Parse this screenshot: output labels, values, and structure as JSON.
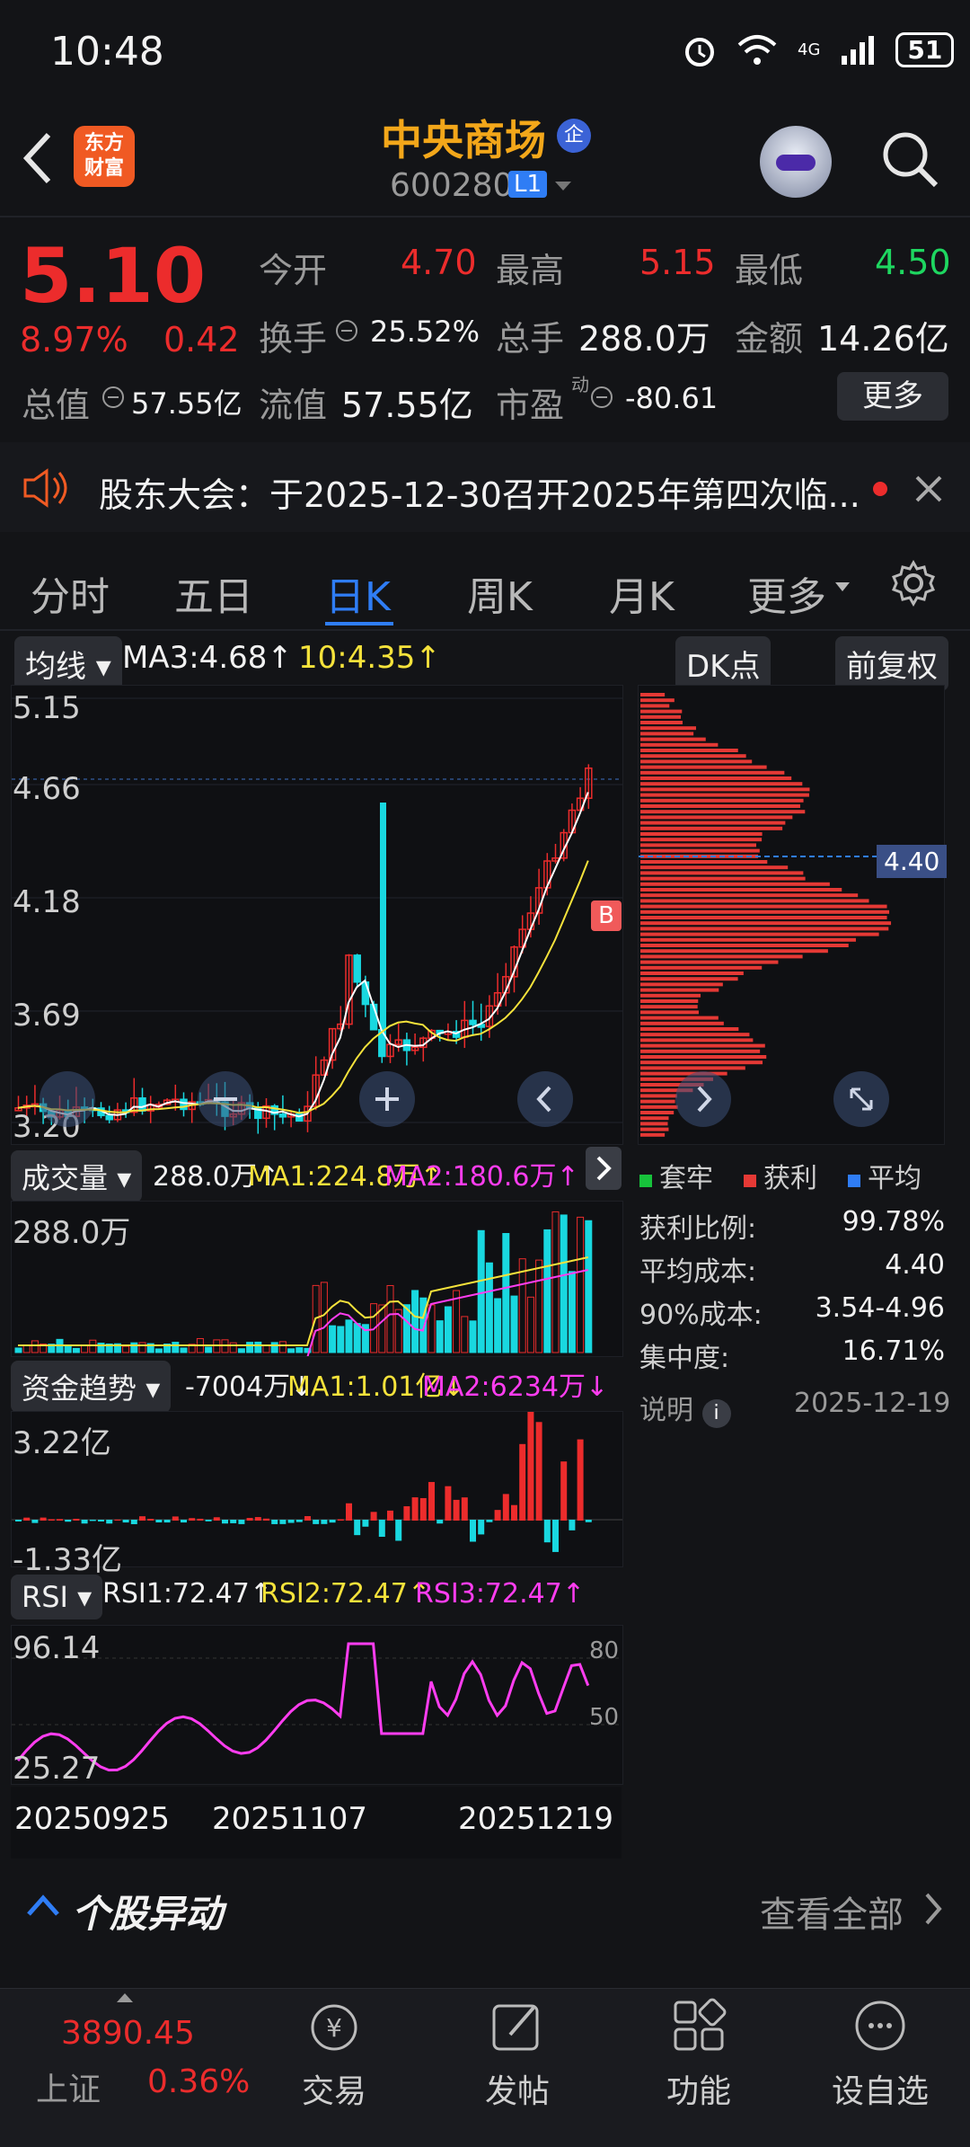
{
  "status_bar": {
    "time": "10:48",
    "battery": "51",
    "signal": "4G"
  },
  "header": {
    "logo_line1": "东方",
    "logo_line2": "财富",
    "stock_name": "中央商场",
    "badge": "企",
    "code": "600280",
    "level": "L1"
  },
  "quote": {
    "price": "5.10",
    "change_pct": "8.97%",
    "change": "0.42",
    "open_label": "今开",
    "open": "4.70",
    "high_label": "最高",
    "high": "5.15",
    "low_label": "最低",
    "low": "4.50",
    "turnover_label": "换手",
    "turnover": "25.52%",
    "volume_label": "总手",
    "volume": "288.0万",
    "amount_label": "金额",
    "amount": "14.26亿",
    "mktcap_label": "总值",
    "mktcap": "57.55亿",
    "float_label": "流值",
    "float": "57.55亿",
    "pe_label": "市盈",
    "pe_sup": "动",
    "pe": "-80.61",
    "more": "更多"
  },
  "notice": {
    "text": "股东大会：于2025-12-30召开2025年第四次临..."
  },
  "tabs": [
    {
      "label": "分时"
    },
    {
      "label": "五日"
    },
    {
      "label": "日K"
    },
    {
      "label": "周K"
    },
    {
      "label": "月K"
    },
    {
      "label": "更多"
    }
  ],
  "ma_bar": {
    "selector": "均线",
    "ma3": "MA3:4.68",
    "ma10": "10:4.35",
    "dk": "DK点",
    "restore": "前复权"
  },
  "kline": {
    "y_labels": [
      "5.15",
      "4.66",
      "4.18",
      "3.69",
      "3.20"
    ],
    "buy_mark": "B",
    "price_line": "4.40"
  },
  "volume": {
    "selector": "成交量",
    "value": "288.0万",
    "ma1": "MA1:224.8万",
    "ma2": "MA2:180.6万",
    "y_top": "288.0万"
  },
  "fund": {
    "selector": "资金趋势",
    "value": "-7004万",
    "ma1": "MA1:1.01亿",
    "ma2": "MA2:6234万",
    "y_top": "3.22亿",
    "y_bottom": "-1.33亿"
  },
  "rsi": {
    "selector": "RSI",
    "rsi1": "RSI1:72.47",
    "rsi2": "RSI2:72.47",
    "rsi3": "RSI3:72.47",
    "y_top": "96.14",
    "y_bottom": "25.27",
    "line80": "80",
    "line50": "50"
  },
  "dates": [
    "20250925",
    "20251107",
    "20251219"
  ],
  "chip": {
    "legend": [
      {
        "label": "套牢",
        "color": "#17c23b"
      },
      {
        "label": "获利",
        "color": "#e53935"
      },
      {
        "label": "平均",
        "color": "#2f7df5"
      }
    ],
    "stats": [
      {
        "k": "获利比例:",
        "v": "99.78%"
      },
      {
        "k": "平均成本:",
        "v": "4.40"
      },
      {
        "k": "90%成本:",
        "v": "3.54-4.96"
      },
      {
        "k": "集中度:",
        "v": "16.71%"
      }
    ],
    "note": "说明",
    "date": "2025-12-19"
  },
  "movement": {
    "title": "个股异动",
    "view_all": "查看全部"
  },
  "bottom_nav": {
    "index_value": "3890.45",
    "index_name": "上证",
    "index_pct": "0.36%",
    "trade": "交易",
    "post": "发帖",
    "func": "功能",
    "watch": "设自选"
  },
  "colors": {
    "up": "#ec2c2c",
    "down": "#1ed760",
    "accent": "#2f7df5",
    "bg": "#131417"
  }
}
